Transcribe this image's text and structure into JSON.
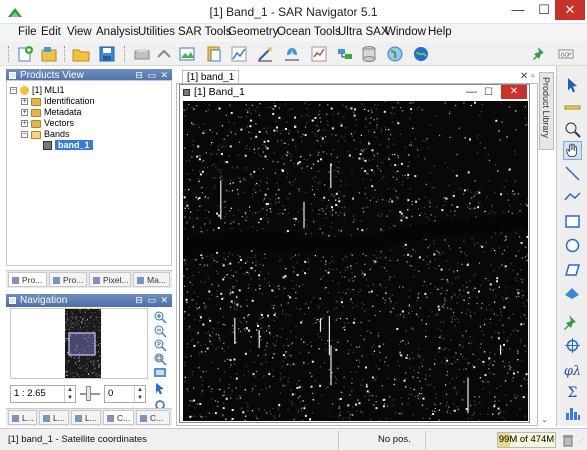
{
  "window": {
    "title": "[1] Band_1 - SAR Navigator 5.1",
    "controls": [
      "—",
      "☐",
      "✕"
    ]
  },
  "menubar": [
    "File",
    "Edit",
    "View",
    "Analysis",
    "Utilities",
    "SAR Tools",
    "Geometry",
    "Ocean Tools",
    "Ultra SAX",
    "Window",
    "Help"
  ],
  "products_view": {
    "title": "Products View",
    "root": "[1] MLI1",
    "nodes": [
      "Identification",
      "Metadata",
      "Vectors",
      "Bands"
    ],
    "band": "band_1",
    "tabs": [
      "Pro...",
      "Pro...",
      "Pixel...",
      "Ma..."
    ]
  },
  "navigation": {
    "title": "Navigation",
    "zoom_value": "1 : 2.65",
    "rotation_value": "0",
    "tabs": [
      "L...",
      "L...",
      "L...",
      "C...",
      "C..."
    ]
  },
  "document": {
    "tab_label": "[1] band_1",
    "window_title": "[1] Band_1"
  },
  "side_panel": {
    "library_label": "Product Library"
  },
  "status": {
    "message": "[1] band_1 - Satellite coordinates",
    "position": "No pos.",
    "memory": "99M of 474M",
    "memory_fraction": 0.21
  }
}
